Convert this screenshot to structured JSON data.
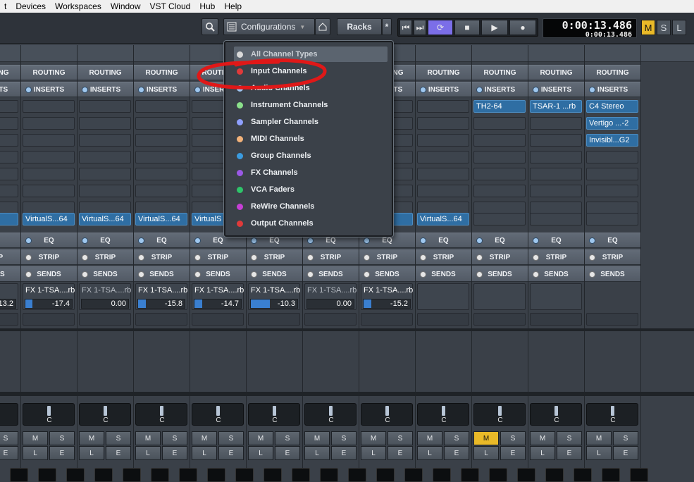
{
  "menubar": [
    "t",
    "Devices",
    "Workspaces",
    "Window",
    "VST Cloud",
    "Hub",
    "Help"
  ],
  "toolbar": {
    "configurations_label": "Configurations",
    "racks_label": "Racks",
    "star": "*",
    "time_main": "0:00:13.486",
    "time_sub": "0:00:13.486",
    "m_label": "M",
    "s_label": "S",
    "l_label": "L"
  },
  "sections": {
    "routing": "ROUTING",
    "inserts": "INSERTS",
    "eq": "EQ",
    "strip": "STRIP",
    "sends": "SENDS"
  },
  "channels": [
    {
      "insert1": "",
      "insert2": "",
      "insert3": "",
      "vst": ".64",
      "send_name": "..rb",
      "send_val": "-13.2",
      "send_fill": 0,
      "pan": "C",
      "mute_on": false
    },
    {
      "insert1": "",
      "insert2": "",
      "insert3": "",
      "vst": "VirtualS...64",
      "send_name": "FX 1-TSA....rb",
      "send_val": "-17.4",
      "send_fill": 0.33,
      "pan": "C",
      "mute_on": false
    },
    {
      "insert1": "",
      "insert2": "",
      "insert3": "",
      "vst": "VirtualS...64",
      "send_name": "FX 1-TSA....rb",
      "send_val": "0.00",
      "send_fill": 0,
      "pan": "C",
      "mute_on": false
    },
    {
      "insert1": "",
      "insert2": "",
      "insert3": "",
      "vst": "VirtualS...64",
      "send_name": "FX 1-TSA....rb",
      "send_val": "-15.8",
      "send_fill": 0.36,
      "pan": "C",
      "mute_on": false
    },
    {
      "insert1": "",
      "insert2": "",
      "insert3": "",
      "vst": "VirtualS",
      "send_name": "FX 1-TSA....rb",
      "send_val": "-14.7",
      "send_fill": 0.38,
      "pan": "C",
      "mute_on": false
    },
    {
      "insert1": "",
      "insert2": "",
      "insert3": "",
      "vst": "",
      "send_name": "FX 1-TSA....rb",
      "send_val": "-10.3",
      "send_fill": 0.9,
      "pan": "C",
      "mute_on": false
    },
    {
      "insert1": "",
      "insert2": "",
      "insert3": "",
      "vst": "",
      "send_name": "FX 1-TSA....rb",
      "send_val": "0.00",
      "send_fill": 0,
      "pan": "C",
      "mute_on": false
    },
    {
      "insert1": "",
      "insert2": "",
      "insert3": "",
      "vst": "64",
      "send_name": "FX 1-TSA....rb",
      "send_val": "-15.2",
      "send_fill": 0.36,
      "pan": "C",
      "mute_on": false
    },
    {
      "insert1": "",
      "insert2": "",
      "insert3": "",
      "vst": "VirtualS...64",
      "send_name": "",
      "send_val": "",
      "send_fill": 0,
      "pan": "C",
      "mute_on": false
    },
    {
      "insert1": "TH2-64",
      "insert2": "",
      "insert3": "",
      "vst": "",
      "send_name": "",
      "send_val": "",
      "send_fill": 0,
      "pan": "C",
      "mute_on": true
    },
    {
      "insert1": "TSAR-1 ...rb",
      "insert2": "",
      "insert3": "",
      "vst": "",
      "send_name": "",
      "send_val": "",
      "send_fill": 0,
      "pan": "C",
      "mute_on": false
    },
    {
      "insert1": "C4 Stereo",
      "insert2": "Vertigo ...-2",
      "insert3": "Invisibl...G2",
      "vst": "",
      "send_name": "",
      "send_val": "",
      "send_fill": 0,
      "pan": "C",
      "mute_on": false
    }
  ],
  "buttons": {
    "m": "M",
    "s": "S",
    "l": "L",
    "e": "E"
  },
  "dropdown": {
    "items": [
      {
        "label": "All Channel Types",
        "color": "#d9d9d9"
      },
      {
        "label": "Input Channels",
        "color": "#e03a3a"
      },
      {
        "label": "Audio Channels",
        "color": "#9ec5f2"
      },
      {
        "label": "Instrument Channels",
        "color": "#8be08b"
      },
      {
        "label": "Sampler Channels",
        "color": "#8fa0ff"
      },
      {
        "label": "MIDI Channels",
        "color": "#f2b27a"
      },
      {
        "label": "Group Channels",
        "color": "#3a9be0"
      },
      {
        "label": "FX Channels",
        "color": "#9b59e6"
      },
      {
        "label": "VCA Faders",
        "color": "#2ec46a"
      },
      {
        "label": "ReWire Channels",
        "color": "#c63fd6"
      },
      {
        "label": "Output Channels",
        "color": "#e03a3a"
      }
    ]
  }
}
